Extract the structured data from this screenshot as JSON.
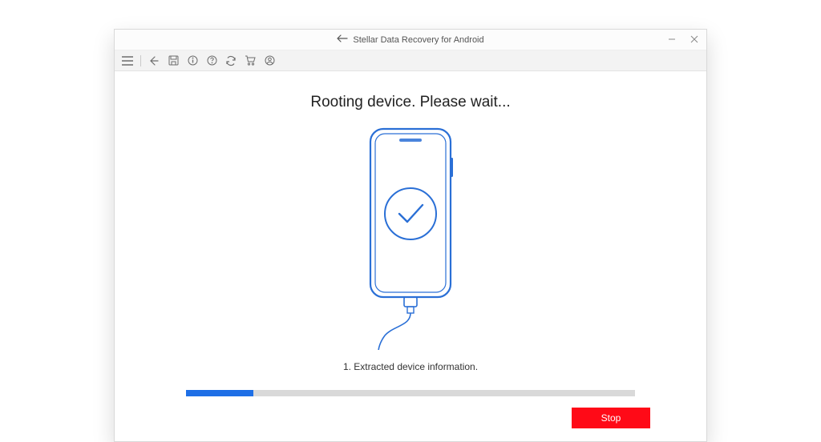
{
  "window": {
    "title": "Stellar Data Recovery for Android"
  },
  "main": {
    "heading": "Rooting device. Please wait...",
    "step_text": "1. Extracted device information.",
    "progress_percent": 15
  },
  "footer": {
    "stop_label": "Stop"
  },
  "colors": {
    "accent": "#1e6fe6",
    "stop": "#ff0a17",
    "phone_stroke": "#2a6fd6"
  }
}
